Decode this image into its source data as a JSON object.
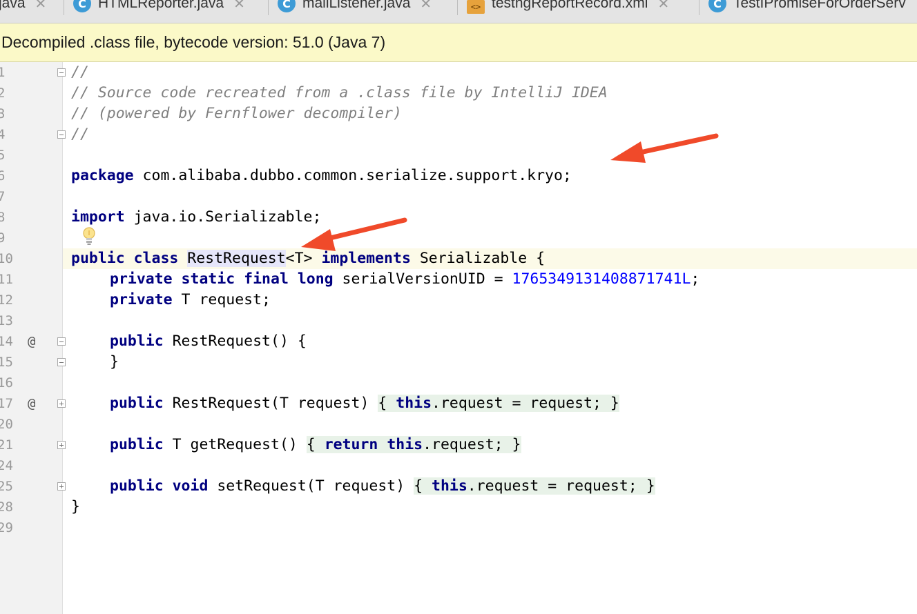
{
  "tabs": [
    {
      "label": "java",
      "icon": "none"
    },
    {
      "label": "HTMLReporter.java",
      "icon": "class-icon"
    },
    {
      "label": "mailListener.java",
      "icon": "class-icon"
    },
    {
      "label": "testngReportRecord.xml",
      "icon": "xml-icon"
    },
    {
      "label": "TestIPromiseForOrderServ",
      "icon": "class-icon"
    }
  ],
  "icons": {
    "class": "C",
    "xml": "<>",
    "close": "✕",
    "gutter_marker": "@"
  },
  "banner": {
    "text": "Decompiled .class file, bytecode version: 51.0 (Java 7)"
  },
  "gutter": {
    "line_numbers": [
      "1",
      "2",
      "3",
      "4",
      "5",
      "6",
      "7",
      "8",
      "9",
      "10",
      "11",
      "12",
      "13",
      "14",
      "15",
      "16",
      "17",
      "20",
      "21",
      "24",
      "25",
      "28",
      "29"
    ]
  },
  "code": {
    "l1": "//",
    "l2": "// Source code recreated from a .class file by IntelliJ IDEA",
    "l3": "// (powered by Fernflower decompiler)",
    "l4": "//",
    "kw_package": "package",
    "pkg_name": " com.alibaba.dubbo.common.serialize.support.kryo;",
    "kw_import": "import",
    "import_name": " java.io.Serializable;",
    "kw_public_class": "public class ",
    "class_name": "RestRequest",
    "class_generic": "<T> ",
    "kw_implements": "implements",
    "class_tail": " Serializable {",
    "kw_psfl": "private static final long",
    "serial_name": " serialVersionUID = ",
    "serial_value": "1765349131408871741L",
    "semicolon": ";",
    "kw_private": "private",
    "field_tail": " T request;",
    "kw_public": "public",
    "ctor_sig": " RestRequest() {",
    "close_brace": "}",
    "ctor2_sig": " RestRequest(T request) ",
    "open_brace": "{",
    "kw_this": "this",
    "assign_tail": ".request = request; ",
    "getter_sig": " T getRequest() ",
    "kw_return": "return",
    "return_tail": ".request; ",
    "kw_public_void": "public void",
    "setter_sig": " setRequest(T request) ",
    "class_close": "}"
  },
  "colors": {
    "keyword": "#000080",
    "comment": "#808080",
    "number": "#0000ff",
    "banner": "#fbf9c8",
    "arrow": "#f04a2a"
  }
}
